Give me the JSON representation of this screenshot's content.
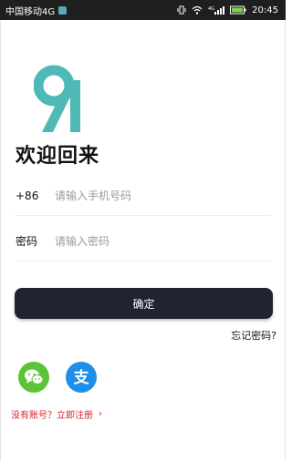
{
  "status_bar": {
    "carrier": "中国移动4G",
    "network": "4G",
    "time": "20:45"
  },
  "login": {
    "welcome": "欢迎回来",
    "phone_label": "+86",
    "phone_placeholder": "请输入手机号码",
    "password_label": "密码",
    "password_placeholder": "请输入密码",
    "confirm_label": "确定",
    "forgot_label": "忘记密码?",
    "register_label": "没有账号？立即注册",
    "register_chevron": "›"
  },
  "social": {
    "alipay_glyph": "支"
  },
  "colors": {
    "logo": "#4fb9b5",
    "button": "#1f2430",
    "wechat": "#5cc436",
    "alipay": "#1e8fe8",
    "register": "#d9232d"
  }
}
